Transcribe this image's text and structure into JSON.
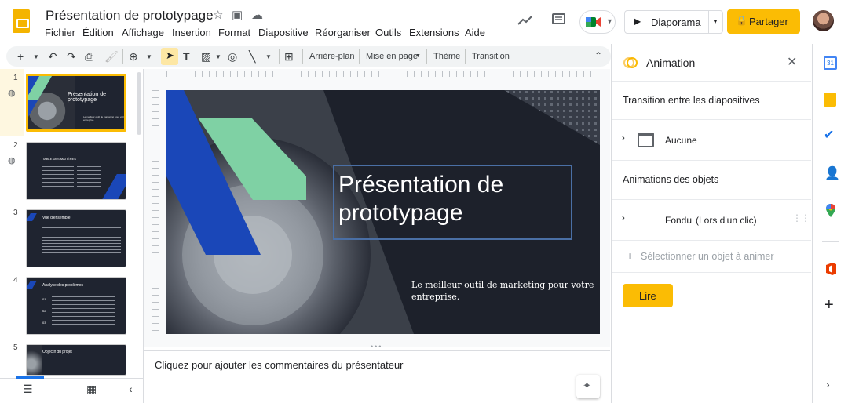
{
  "header": {
    "title": "Présentation de prototypage",
    "menus": [
      "Fichier",
      "Édition",
      "Affichage",
      "Insertion",
      "Format",
      "Diapositive",
      "Réorganiser",
      "Outils",
      "Extensions",
      "Aide"
    ],
    "slideshow_label": "Diaporama",
    "share_label": "Partager"
  },
  "toolbar": {
    "background_label": "Arrière-plan",
    "layout_label": "Mise en page",
    "theme_label": "Thème",
    "transition_label": "Transition"
  },
  "filmstrip": {
    "slides": [
      {
        "num": "1",
        "title": "Présentation de prototypage",
        "subtitle": "Le meilleur outil de marketing pour votre entreprise."
      },
      {
        "num": "2",
        "title": "TABLE DES MATIÈRES"
      },
      {
        "num": "3",
        "title": "Vue d'ensemble"
      },
      {
        "num": "4",
        "title": "Analyse des problèmes",
        "items": [
          "01",
          "02",
          "03"
        ]
      },
      {
        "num": "5",
        "title": "Objectif du projet"
      }
    ]
  },
  "slide": {
    "title_line1": "Présentation de",
    "title_line2": "prototypage",
    "subtitle_line1": "Le meilleur outil de marketing pour votre",
    "subtitle_line2": "entreprise."
  },
  "notes": {
    "placeholder": "Cliquez pour ajouter les commentaires du présentateur"
  },
  "panel": {
    "title": "Animation",
    "transition_heading": "Transition entre les diapositives",
    "transition_value": "Aucune",
    "objects_heading": "Animations des objets",
    "object_anim_name": "Fondu",
    "object_anim_trigger": "(Lors d'un clic)",
    "select_object_label": "Sélectionner un objet à animer",
    "play_label": "Lire"
  },
  "colors": {
    "accent": "#fbbc04",
    "slide_bg": "#1d212b",
    "blue": "#1a47b8",
    "green": "#7fd1a4",
    "title_box": "#4a6fa5"
  }
}
